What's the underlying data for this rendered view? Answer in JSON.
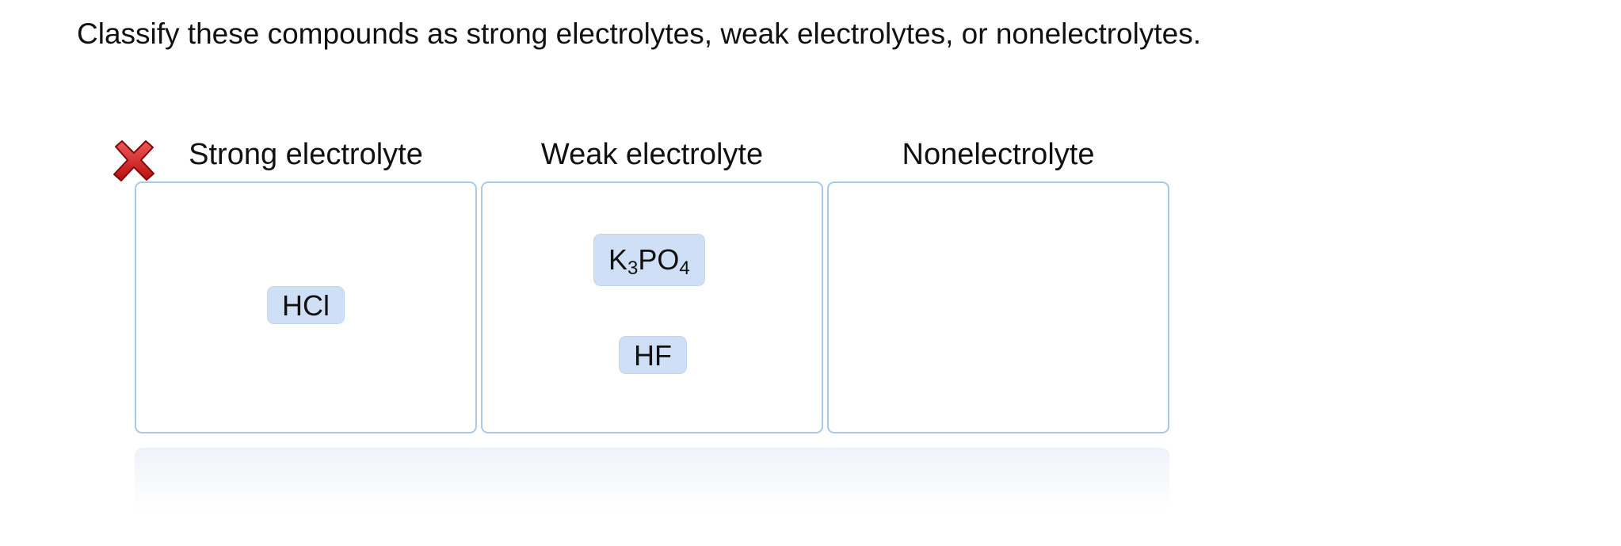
{
  "prompt": "Classify these compounds as strong electrolytes, weak electrolytes, or nonelectrolytes.",
  "status": {
    "icon": "incorrect-x-icon",
    "color": "#cc1616"
  },
  "bins": [
    {
      "label": "Strong electrolyte",
      "items": [
        {
          "formula": "HCl"
        }
      ]
    },
    {
      "label": "Weak electrolyte",
      "items": [
        {
          "formula_parts": [
            "K",
            "3",
            "PO",
            "4"
          ]
        },
        {
          "formula": "HF"
        }
      ]
    },
    {
      "label": "Nonelectrolyte",
      "items": []
    }
  ],
  "colors": {
    "bin_border": "#a9c8ea",
    "chip_fill": "#cfe0f6"
  }
}
